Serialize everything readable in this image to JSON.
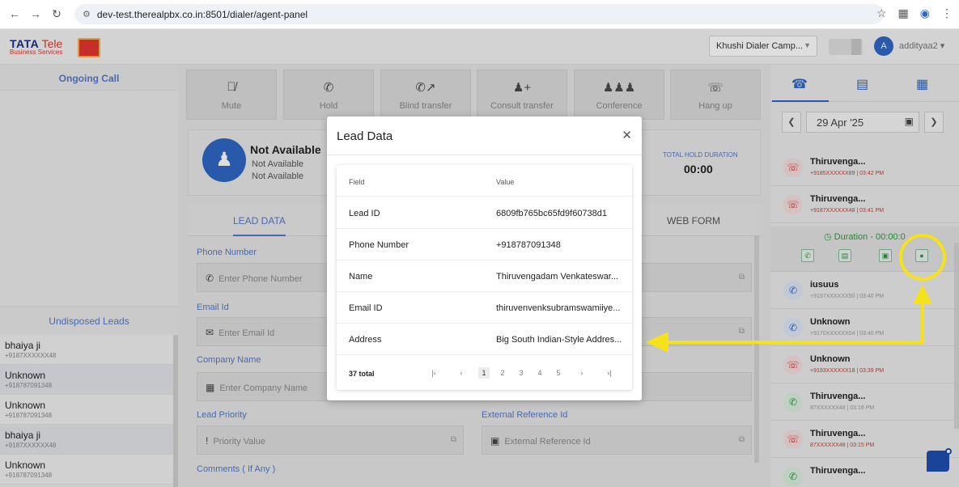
{
  "browser": {
    "url": "dev-test.therealpbx.co.in:8501/dialer/agent-panel"
  },
  "header": {
    "logo_brand": "TATA",
    "logo_tele": "Tele",
    "logo_sub": "Business Services",
    "campaign": "Khushi Dialer Camp...",
    "avatar_initial": "A",
    "username": "addityaa2"
  },
  "left_panel": {
    "ongoing_title": "Ongoing Call",
    "undisposed_title": "Undisposed Leads",
    "leads": [
      {
        "name": "bhaiya ji",
        "phone": "+9187XXXXXX48"
      },
      {
        "name": "Unknown",
        "phone": "+918787091348"
      },
      {
        "name": "Unknown",
        "phone": "+918787091348"
      },
      {
        "name": "bhaiya ji",
        "phone": "+9187XXXXXX48"
      },
      {
        "name": "Unknown",
        "phone": "+918787091348"
      }
    ]
  },
  "call_controls": [
    {
      "label": "Mute",
      "icon": "mic-off-icon"
    },
    {
      "label": "Hold",
      "icon": "phone-pause-icon"
    },
    {
      "label": "Blind transfer",
      "icon": "phone-forward-icon"
    },
    {
      "label": "Consult transfer",
      "icon": "user-plus-icon"
    },
    {
      "label": "Conference",
      "icon": "group-icon"
    },
    {
      "label": "Hang up",
      "icon": "phone-hangup-icon"
    }
  ],
  "status": {
    "main": "Not Available",
    "sub1": "Not Available",
    "sub2": "Not Available",
    "hold_label": "TOTAL HOLD DURATION",
    "hold_value": "00:00"
  },
  "tabs": {
    "lead_data": "LEAD DATA",
    "web_form": "WEB FORM"
  },
  "form": {
    "phone_label": "Phone Number",
    "phone_placeholder": "Enter Phone Number",
    "email_label": "Email Id",
    "email_placeholder": "Enter Email Id",
    "company_label": "Company Name",
    "company_placeholder": "Enter Company Name",
    "priority_label": "Lead Priority",
    "priority_placeholder": "Priority Value",
    "extref_label": "External Reference Id",
    "extref_placeholder": "External Reference Id",
    "comments_label": "Comments ( If Any )"
  },
  "right_panel": {
    "date": "29 Apr '25",
    "duration": "Duration - 00:00:0",
    "calls_top": [
      {
        "name": "Thiruvenga...",
        "number": "+9185XXXXXX89 | 03:42 PM",
        "type": "missed"
      },
      {
        "name": "Thiruvenga...",
        "number": "+9187XXXXXX48 | 03:41 PM",
        "type": "missed"
      }
    ],
    "calls_bottom": [
      {
        "name": "iusuus",
        "number": "+9197XXXXXX50 | 03:40 PM",
        "type": "incoming"
      },
      {
        "name": "Unknown",
        "number": "+9170XXXXXX04 | 03:40 PM",
        "type": "incoming"
      },
      {
        "name": "Unknown",
        "number": "+9193XXXXXX18 | 03:39 PM",
        "type": "missed"
      },
      {
        "name": "Thiruvenga...",
        "number": "87XXXXXX48 | 03:16 PM",
        "type": "answered"
      },
      {
        "name": "Thiruvenga...",
        "number": "87XXXXXX48 | 03:15 PM",
        "type": "missed"
      },
      {
        "name": "Thiruvenga...",
        "number": "",
        "type": "answered"
      }
    ]
  },
  "modal": {
    "title": "Lead Data",
    "col_field": "Field",
    "col_value": "Value",
    "rows": [
      {
        "field": "Lead ID",
        "value": "6809fb765bc65fd9f60738d1"
      },
      {
        "field": "Phone Number",
        "value": "+918787091348"
      },
      {
        "field": "Name",
        "value": "Thiruvengadam Venkateswar..."
      },
      {
        "field": "Email ID",
        "value": "thiruvenvenksubramswamiiye..."
      },
      {
        "field": "Address",
        "value": "Big South Indian-Style Addres..."
      }
    ],
    "total": "37 total",
    "pages": [
      "1",
      "2",
      "3",
      "4",
      "5"
    ]
  },
  "colors": {
    "accent": "#2f67c4",
    "annotation": "#f5e21b",
    "missed": "#d33333",
    "answered": "#2c9a3f"
  }
}
